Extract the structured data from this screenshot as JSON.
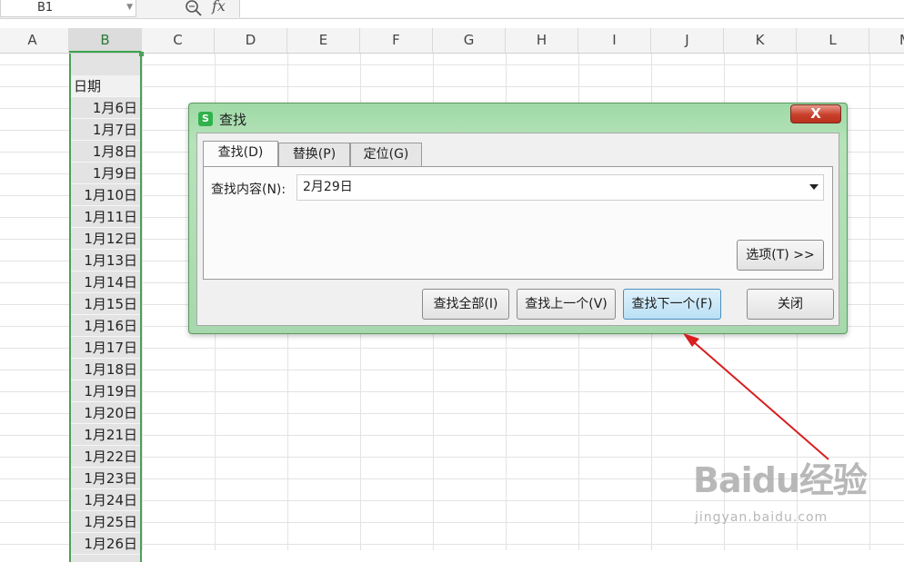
{
  "formula_bar": {
    "cell_ref": "B1",
    "fx_label": "fx"
  },
  "grid": {
    "columns": [
      {
        "label": "A"
      },
      {
        "label": "B"
      },
      {
        "label": "C"
      },
      {
        "label": "D"
      },
      {
        "label": "E"
      },
      {
        "label": "F"
      },
      {
        "label": "G"
      },
      {
        "label": "H"
      },
      {
        "label": "I"
      },
      {
        "label": "J"
      },
      {
        "label": "K"
      },
      {
        "label": "L"
      },
      {
        "label": "M"
      }
    ],
    "selected_column": "B",
    "column_b_header": "日期",
    "column_b_values": [
      "1月6日",
      "1月7日",
      "1月8日",
      "1月9日",
      "1月10日",
      "1月11日",
      "1月12日",
      "1月13日",
      "1月14日",
      "1月15日",
      "1月16日",
      "1月17日",
      "1月18日",
      "1月19日",
      "1月20日",
      "1月21日",
      "1月22日",
      "1月23日",
      "1月24日",
      "1月25日",
      "1月26日"
    ]
  },
  "dialog": {
    "title": "查找",
    "close_label": "X",
    "tabs": [
      {
        "label": "查找(D)",
        "active": true
      },
      {
        "label": "替换(P)",
        "active": false
      },
      {
        "label": "定位(G)",
        "active": false
      }
    ],
    "find_label": "查找内容(N):",
    "find_value": "2月29日",
    "options_button": "选项(T) >>",
    "buttons": {
      "find_all": "查找全部(I)",
      "find_prev": "查找上一个(V)",
      "find_next": "查找下一个(F)",
      "close": "关闭"
    }
  },
  "annotation": {
    "arrow_color": "#d81e1e"
  },
  "watermark": {
    "logo_text": "Baidu经验",
    "url": "jingyan.baidu.com"
  }
}
